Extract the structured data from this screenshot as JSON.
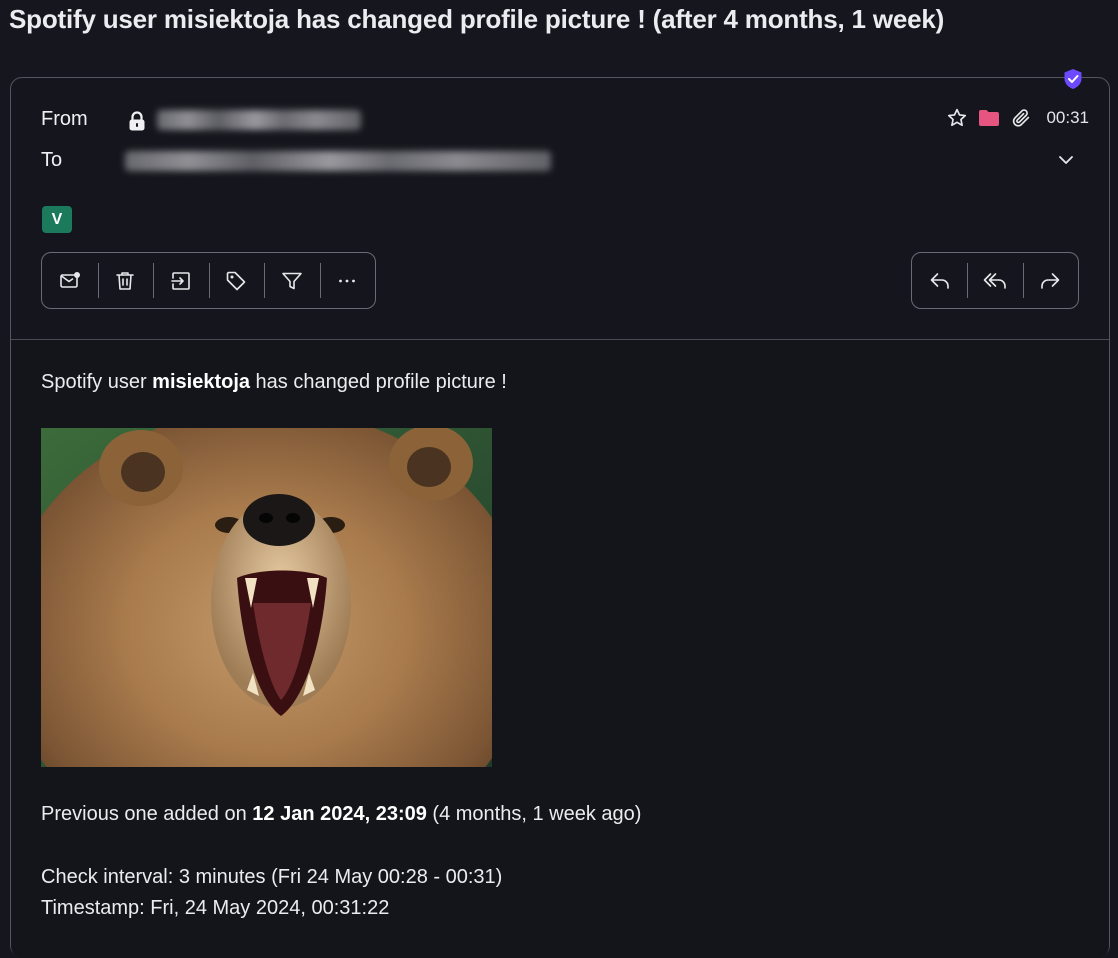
{
  "subject": "Spotify user misiektoja has changed profile picture ! (after 4 months, 1 week)",
  "header": {
    "from_label": "From",
    "to_label": "To",
    "time": "00:31",
    "badge": "V",
    "icons": [
      "shield-check-icon",
      "lock-icon",
      "star-icon",
      "folder-icon",
      "paperclip-icon",
      "chevron-down-icon"
    ],
    "folder_color": "#e5557f",
    "shield_color": "#6d4aff"
  },
  "toolbar_left": [
    {
      "name": "mark-unread-button",
      "icon": "mail-dot-icon"
    },
    {
      "name": "trash-button",
      "icon": "trash-icon"
    },
    {
      "name": "move-button",
      "icon": "move-to-folder-icon"
    },
    {
      "name": "label-button",
      "icon": "tag-icon"
    },
    {
      "name": "filter-button",
      "icon": "filter-icon"
    },
    {
      "name": "more-button",
      "icon": "more-horizontal-icon"
    }
  ],
  "toolbar_right": [
    {
      "name": "reply-button",
      "icon": "reply-icon"
    },
    {
      "name": "reply-all-button",
      "icon": "reply-all-icon"
    },
    {
      "name": "forward-button",
      "icon": "forward-icon"
    }
  ],
  "body": {
    "line1_pre": "Spotify user ",
    "line1_user": "misiektoja",
    "line1_post": " has changed profile picture !",
    "image_alt": "bear-profile-picture",
    "prev_pre": "Previous one added on ",
    "prev_date": "12 Jan 2024, 23:09",
    "prev_post": " (4 months, 1 week ago)",
    "check_interval": "Check interval: 3 minutes (Fri 24 May 00:28 - 00:31)",
    "timestamp": "Timestamp: Fri, 24 May 2024, 00:31:22"
  }
}
